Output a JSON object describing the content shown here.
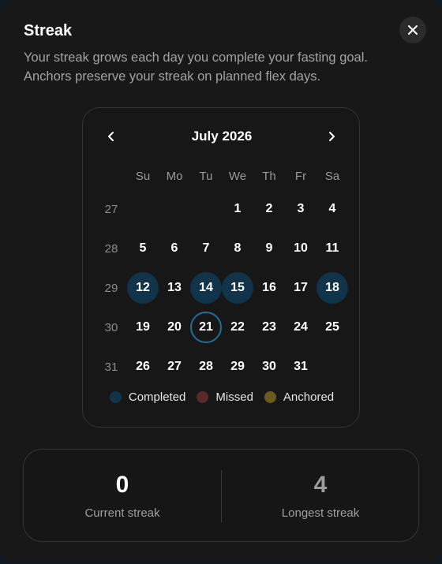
{
  "modal": {
    "title": "Streak",
    "description_lines": [
      "Your streak grows each day you complete your fasting goal.",
      "Anchors preserve your streak on planned flex days."
    ],
    "close_icon": "close-icon"
  },
  "calendar": {
    "month_label": "July 2026",
    "prev_icon": "chevron-left-icon",
    "next_icon": "chevron-right-icon",
    "weekdays": [
      "Su",
      "Mo",
      "Tu",
      "We",
      "Th",
      "Fr",
      "Sa"
    ],
    "weeks": [
      {
        "week": "27",
        "days": [
          "",
          "",
          "",
          "1",
          "2",
          "3",
          "4"
        ]
      },
      {
        "week": "28",
        "days": [
          "5",
          "6",
          "7",
          "8",
          "9",
          "10",
          "11"
        ]
      },
      {
        "week": "29",
        "days": [
          "12",
          "13",
          "14",
          "15",
          "16",
          "17",
          "18"
        ]
      },
      {
        "week": "30",
        "days": [
          "19",
          "20",
          "21",
          "22",
          "23",
          "24",
          "25"
        ]
      },
      {
        "week": "31",
        "days": [
          "26",
          "27",
          "28",
          "29",
          "30",
          "31",
          ""
        ]
      }
    ],
    "completed_days": [
      "12",
      "14",
      "15",
      "18"
    ],
    "today": "21"
  },
  "legend": [
    {
      "label": "Completed",
      "color": "#12344a"
    },
    {
      "label": "Missed",
      "color": "#5a2a2a"
    },
    {
      "label": "Anchored",
      "color": "#6b5a1c"
    }
  ],
  "stats": {
    "current_value": "0",
    "current_label": "Current streak",
    "longest_value": "4",
    "longest_label": "Longest streak"
  }
}
